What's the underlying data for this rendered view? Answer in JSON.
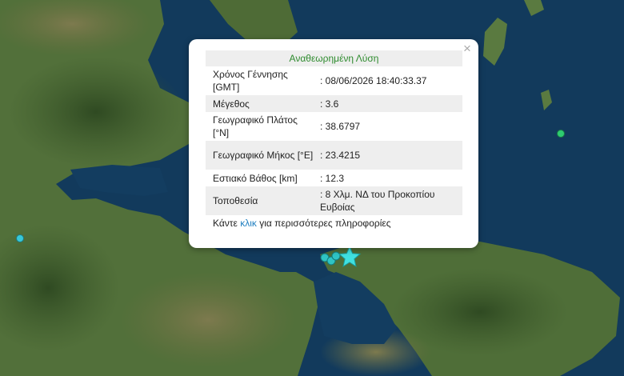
{
  "popup": {
    "title": "Αναθεωρημένη Λύση",
    "close_glyph": "×",
    "rows": [
      {
        "label": "Χρόνος Γέννησης [GMT]",
        "value": ": 08/06/2026 18:40:33.37"
      },
      {
        "label": "Μέγεθος",
        "value": ": 3.6"
      },
      {
        "label": "Γεωγραφικό Πλάτος [°N]",
        "value": ": 38.6797"
      },
      {
        "label": "Γεωγραφικό Μήκος [°E]",
        "value": ": 23.4215"
      },
      {
        "label": "Εστιακό Βάθος [km]",
        "value": ": 12.3"
      },
      {
        "label": "Τοποθεσία",
        "value": ": 8 Χλμ. ΝΔ του Προκοπίου Ευβοίας"
      }
    ],
    "more": {
      "prefix": "Κάντε ",
      "link": "κλικ",
      "suffix": " για περισσότερες πληροφορίες"
    }
  },
  "map": {
    "markers": [
      {
        "name": "epicenter-star-marker",
        "kind": "star",
        "color": "#40e0e0"
      },
      {
        "name": "event-marker-east",
        "kind": "dot",
        "color": "#2ecc71"
      },
      {
        "name": "event-marker-west",
        "kind": "dot",
        "color": "#38c8d8"
      }
    ],
    "colors": {
      "sea": "#123a5c",
      "land": "#4a6a35",
      "accent": "#2e8b2e",
      "link": "#1f7fc0"
    }
  }
}
